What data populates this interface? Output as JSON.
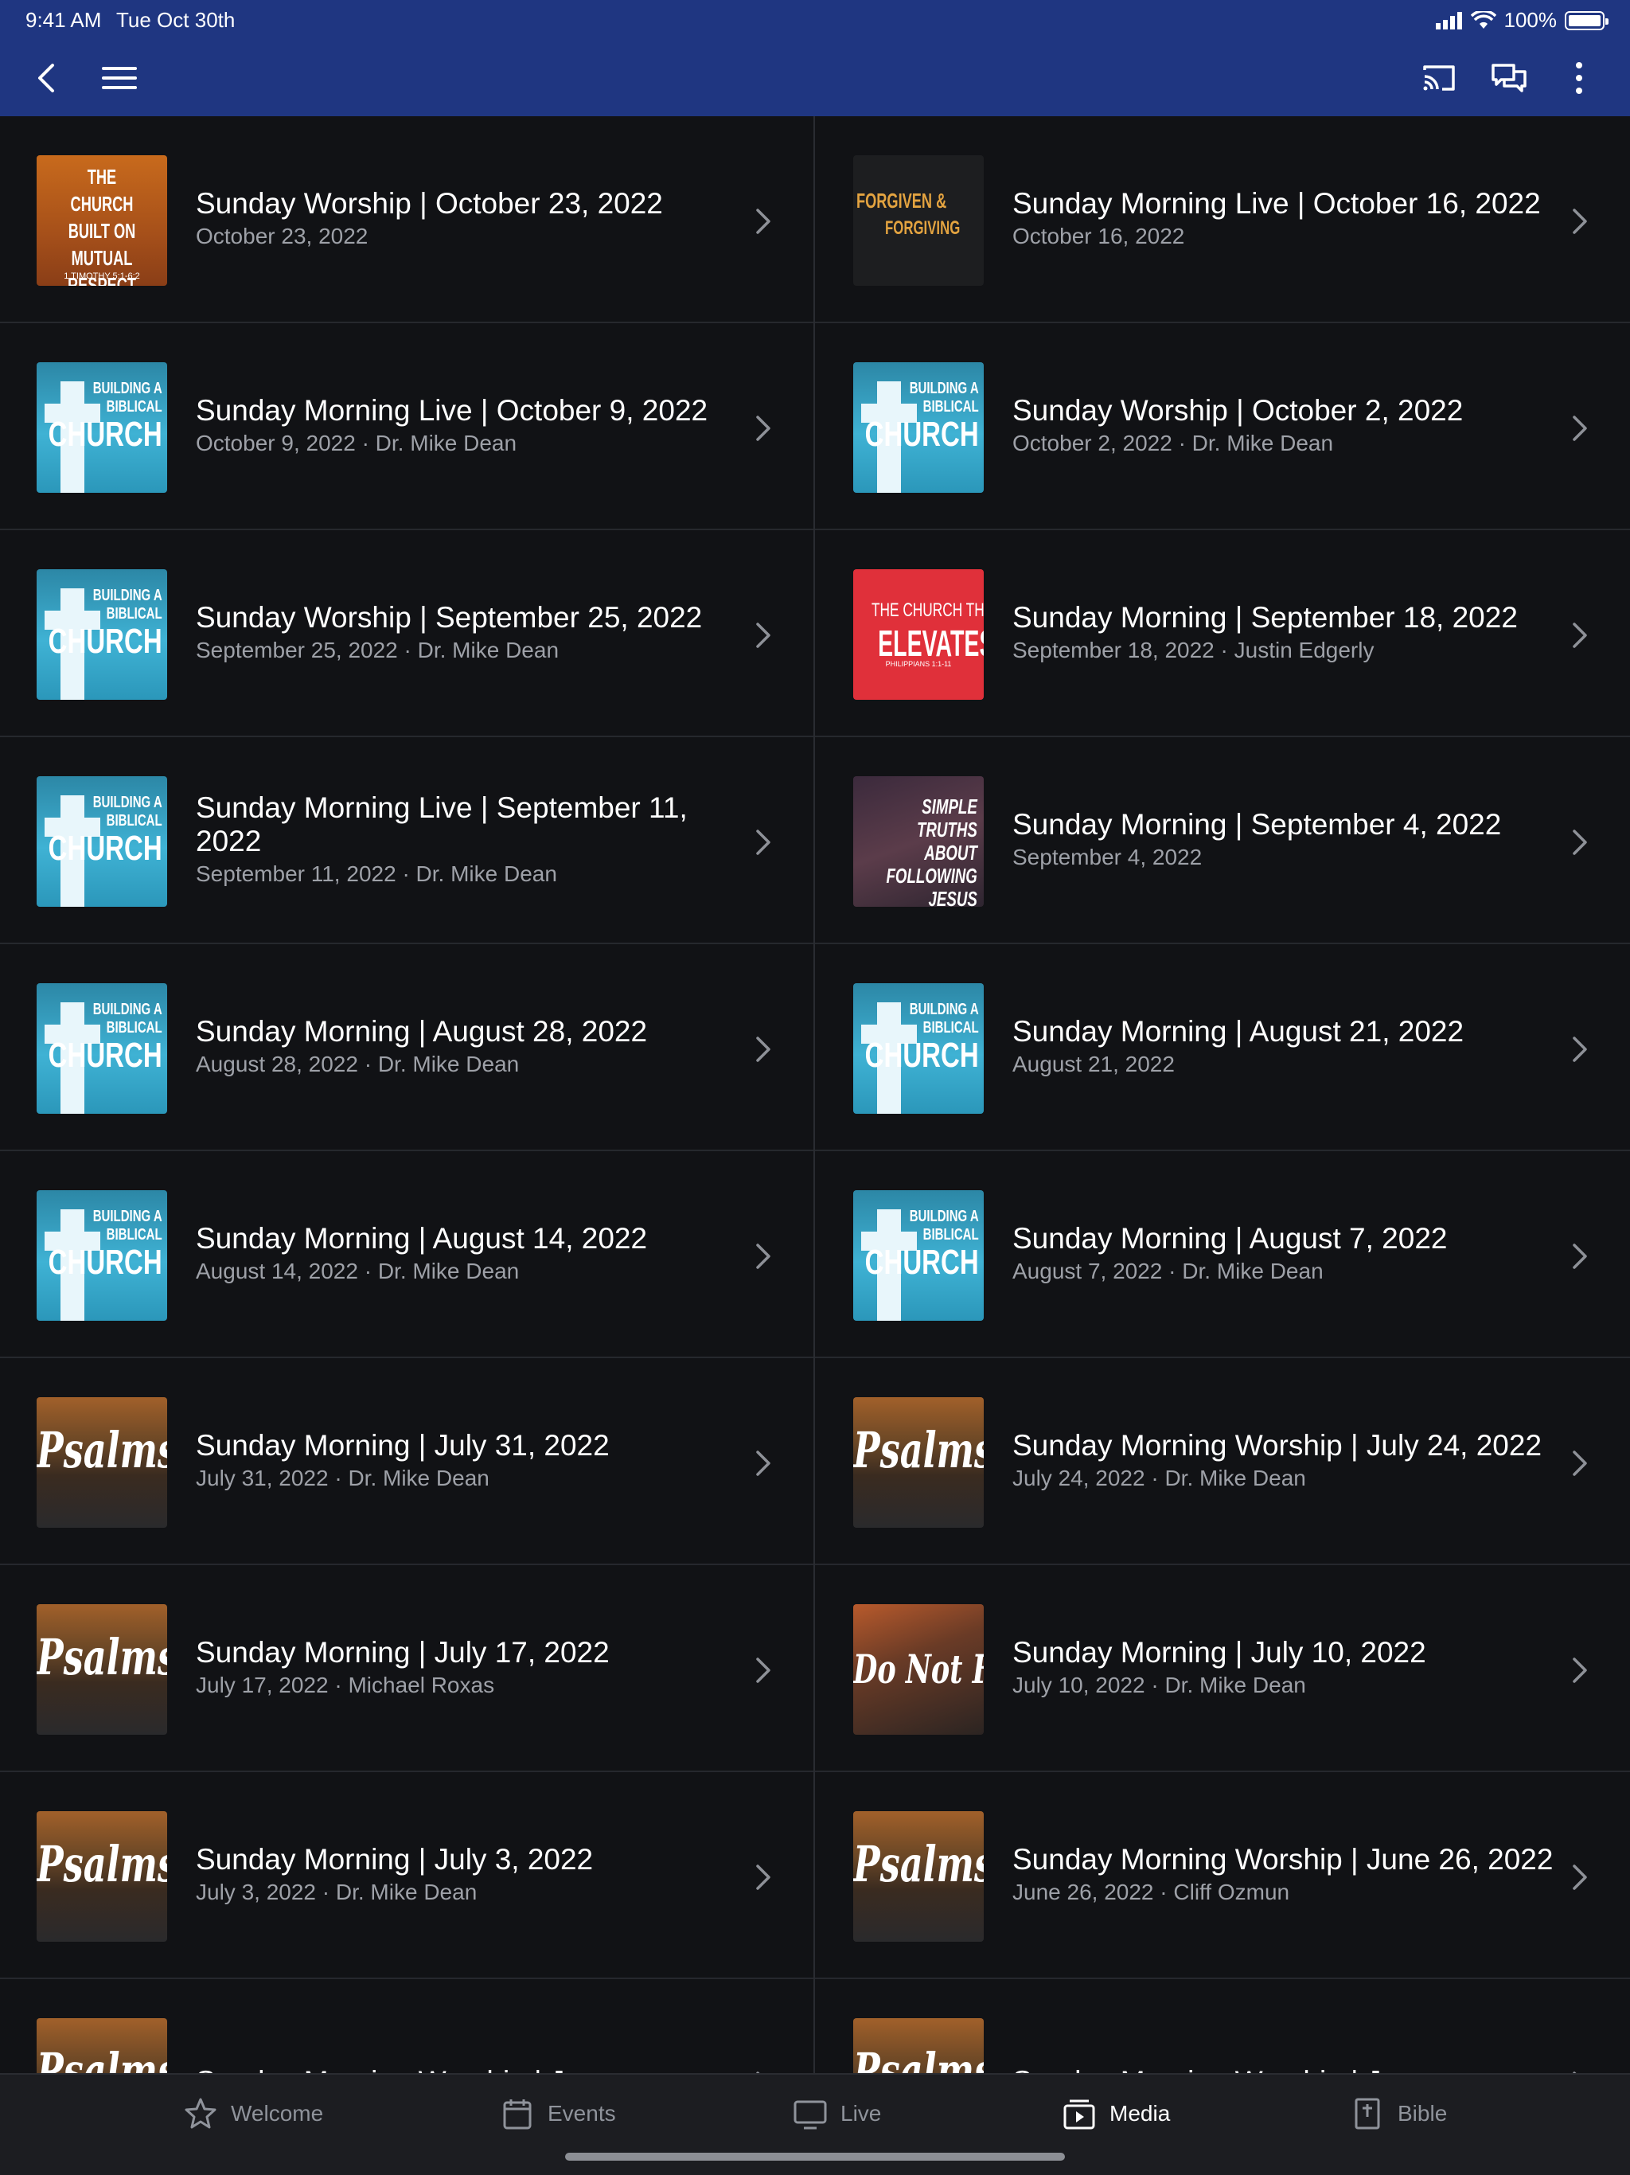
{
  "status_bar": {
    "time": "9:41 AM",
    "date": "Tue Oct 30th",
    "battery": "100%"
  },
  "nav": {
    "back_icon": "chevron-left-icon",
    "menu_icon": "hamburger-icon",
    "cast_icon": "cast-icon",
    "chat_icon": "chat-bubbles-icon",
    "more_icon": "vertical-ellipsis-icon"
  },
  "media": {
    "left": [
      {
        "title": "Sunday Worship | October 23, 2022",
        "subtitle": "October 23, 2022",
        "art": "mutual"
      },
      {
        "title": "Sunday Morning Live | October 9, 2022",
        "subtitle": "October 9, 2022 · Dr. Mike Dean",
        "art": "bbc"
      },
      {
        "title": "Sunday Worship | September 25, 2022",
        "subtitle": "September 25, 2022 · Dr. Mike Dean",
        "art": "bbc"
      },
      {
        "title": "Sunday Morning Live | September 11, 2022",
        "subtitle": "September 11, 2022 · Dr. Mike Dean",
        "art": "bbc"
      },
      {
        "title": "Sunday Morning | August 28, 2022",
        "subtitle": "August 28, 2022 · Dr. Mike Dean",
        "art": "bbc"
      },
      {
        "title": "Sunday Morning | August 14, 2022",
        "subtitle": "August 14, 2022 · Dr. Mike Dean",
        "art": "bbc"
      },
      {
        "title": "Sunday Morning | July 31, 2022",
        "subtitle": "July 31, 2022 · Dr. Mike Dean",
        "art": "psalms"
      },
      {
        "title": "Sunday Morning | July 17, 2022",
        "subtitle": "July 17, 2022 · Michael Roxas",
        "art": "psalms"
      },
      {
        "title": "Sunday Morning | July 3, 2022",
        "subtitle": "July 3, 2022 · Dr. Mike Dean",
        "art": "psalms"
      },
      {
        "title": "Sunday Morning Worship | June",
        "subtitle": "",
        "art": "psalms"
      }
    ],
    "right": [
      {
        "title": "Sunday Morning Live | October 16, 2022",
        "subtitle": "October 16, 2022",
        "art": "forgiven"
      },
      {
        "title": "Sunday Worship | October 2, 2022",
        "subtitle": "October 2, 2022 · Dr. Mike Dean",
        "art": "bbc"
      },
      {
        "title": "Sunday Morning | September 18, 2022",
        "subtitle": "September 18, 2022 · Justin Edgerly",
        "art": "elevates"
      },
      {
        "title": "Sunday Morning | September 4, 2022",
        "subtitle": "September 4, 2022",
        "art": "simple"
      },
      {
        "title": "Sunday Morning | August 21, 2022",
        "subtitle": "August 21, 2022",
        "art": "bbc"
      },
      {
        "title": "Sunday Morning | August 7, 2022",
        "subtitle": "August 7, 2022 · Dr. Mike Dean",
        "art": "bbc"
      },
      {
        "title": "Sunday Morning Worship | July 24, 2022",
        "subtitle": "July 24, 2022 · Dr. Mike Dean",
        "art": "psalms"
      },
      {
        "title": "Sunday Morning | July 10, 2022",
        "subtitle": "July 10, 2022 · Dr. Mike Dean",
        "art": "donot"
      },
      {
        "title": "Sunday Morning Worship | June 26, 2022",
        "subtitle": "June 26, 2022 · Cliff Ozmun",
        "art": "psalms"
      },
      {
        "title": "Sunday Morning Worship | June",
        "subtitle": "",
        "art": "psalms"
      }
    ]
  },
  "artwork_text": {
    "bbc": {
      "line1": "BUILDING A",
      "line2": "BIBLICAL",
      "line3": "CHURCH"
    },
    "psalms": "Psalms",
    "donot": "Do Not Fre",
    "mutual": {
      "lines": [
        "THE CHURCH",
        "BUILT ON",
        "MUTUAL",
        "RESPECT"
      ],
      "ref": "1 TIMOTHY 5:1-6:2"
    },
    "forgiven": {
      "a": "FORGIVEN &",
      "b": "FORGIVING"
    },
    "elevates": {
      "a": "THE CHURCH THAT",
      "b": "ELEVATES",
      "c": "PHILIPPIANS 1:1-11"
    },
    "simple": {
      "lines": [
        "SIMPLE TRUTHS",
        "ABOUT",
        "FOLLOWING",
        "JESUS"
      ]
    }
  },
  "tabs": [
    {
      "label": "Welcome",
      "icon": "star-icon",
      "active": false
    },
    {
      "label": "Events",
      "icon": "calendar-icon",
      "active": false
    },
    {
      "label": "Live",
      "icon": "tv-icon",
      "active": false
    },
    {
      "label": "Media",
      "icon": "media-play-icon",
      "active": true
    },
    {
      "label": "Bible",
      "icon": "bible-icon",
      "active": false
    }
  ],
  "colors": {
    "header": "#1f3681",
    "background": "#111215",
    "tabbar": "#1c1d21",
    "subtitle": "#9ea1a8"
  }
}
